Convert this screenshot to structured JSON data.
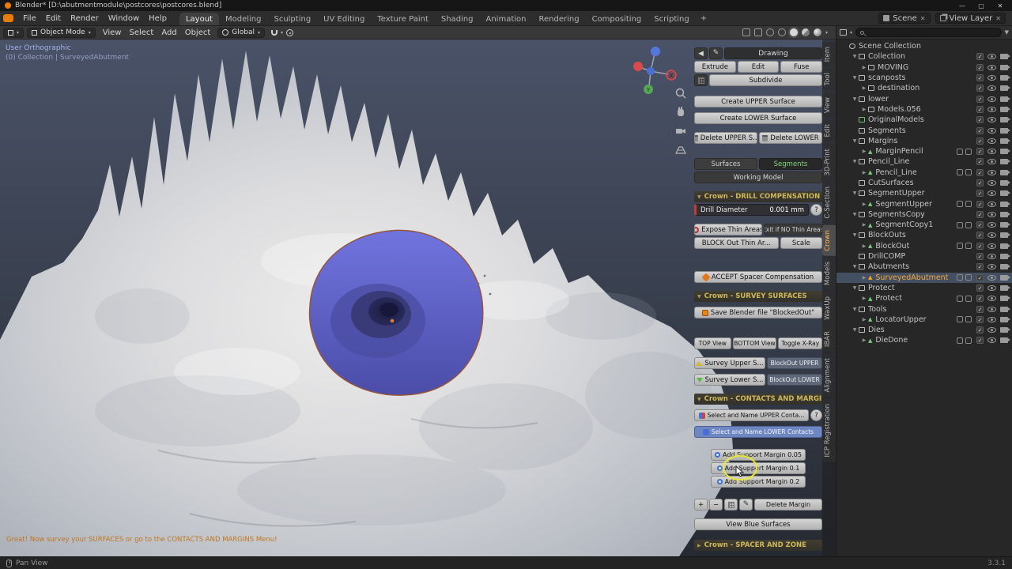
{
  "icons": {
    "minimize": "—",
    "maximize": "▢",
    "close": "✕",
    "dropdown": "▾",
    "collapse": "◀",
    "pencil": "✎",
    "plus": "+",
    "minus": "−",
    "help": "?",
    "check": "✓",
    "arrow_down": "▼",
    "arrow_right": "▶",
    "funnel": "▼",
    "workspace_add": "+",
    "mesh_triangle": "▲"
  },
  "titlebar": {
    "title": "Blender* [D:\\abutmentmodule\\postcores\\postcores.blend]"
  },
  "menubar": {
    "menus": [
      "File",
      "Edit",
      "Render",
      "Window",
      "Help"
    ],
    "workspaces": [
      "Layout",
      "Modeling",
      "Sculpting",
      "UV Editing",
      "Texture Paint",
      "Shading",
      "Animation",
      "Rendering",
      "Compositing",
      "Scripting"
    ],
    "active_workspace": "Layout",
    "scene_label": "Scene",
    "view_layer_label": "View Layer"
  },
  "toolbar": {
    "mode": "Object Mode",
    "menus": [
      "View",
      "Select",
      "Add",
      "Object"
    ],
    "orientation": "Global"
  },
  "viewport": {
    "overlay_line1": "User Orthographic",
    "overlay_line2": "(0) Collection | SurveyedAbutment",
    "hint": "Great! Now survey your SURFACES or go to the CONTACTS AND MARGINS Menu!",
    "axis_x": "X",
    "axis_y": "Y",
    "axis_z": "Z"
  },
  "panel": {
    "drawing_title": "Drawing",
    "extrude": "Extrude",
    "edit": "Edit",
    "fuse": "Fuse",
    "subdivide": "Subdivide",
    "create_upper": "Create UPPER Surface",
    "create_lower": "Create LOWER Surface",
    "delete_upper": "Delete UPPER S...",
    "delete_lower": "Delete LOWER",
    "tab_surfaces": "Surfaces",
    "tab_segments": "Segments",
    "working_model": "Working Model",
    "section_drill": "Crown - DRILL COMPENSATION",
    "drill_label": "Drill Diameter",
    "drill_value": "0.001 mm",
    "expose_thin": "Expose Thin Areas",
    "exit_thin": "Exit if NO Thin Areas",
    "block_thin": "BLOCK Out Thin Ar...",
    "scale": "Scale",
    "accept_spacer": "ACCEPT Spacer Compensation",
    "section_survey": "Crown - SURVEY SURFACES",
    "save_file": "Save Blender file \"BlockedOut\"",
    "top_view": "TOP View",
    "bottom_view": "BOTTOM View",
    "toggle_xray": "Toggle X-Ray",
    "survey_upper": "Survey Upper S...",
    "blockout_upper": "BlockOut UPPER",
    "survey_lower": "Survey Lower S...",
    "blockout_lower": "BlockOut LOWER",
    "section_contacts": "Crown - CONTACTS AND MARGINS",
    "select_upper": "Select and Name UPPER Conta...",
    "select_lower": "Select and Name LOWER Contacts",
    "margin_005": "Add Support Margin 0.05",
    "margin_01": "Add Support Margin 0.1",
    "margin_02": "Add Support Margin 0.2",
    "delete_margin": "Delete Margin",
    "view_blue": "View Blue Surfaces",
    "section_spacer": "Crown - SPACER AND ZONE"
  },
  "side_tabs": [
    "Item",
    "Tool",
    "View",
    "Edit",
    "3D-Print",
    "C-Section",
    "Crown",
    "Models",
    "WaxUp",
    "IBAR",
    "Alignment",
    "ICP Registration"
  ],
  "active_side_tab": "Crown",
  "outliner": {
    "root_label": "Scene Collection",
    "row_icons": [
      "exclude-checkbox",
      "hide-in-viewport-icon",
      "disable-in-render-icon"
    ],
    "items": [
      {
        "indent": 1,
        "arrow": "d",
        "icon": "collection",
        "label": "Collection",
        "extras": false,
        "selected": false
      },
      {
        "indent": 2,
        "arrow": "r",
        "icon": "collection",
        "label": "MOVING",
        "extras": false,
        "selected": false
      },
      {
        "indent": 1,
        "arrow": "d",
        "icon": "collection",
        "label": "scanposts",
        "extras": false,
        "selected": false
      },
      {
        "indent": 2,
        "arrow": "r",
        "icon": "collection",
        "label": "destination",
        "extras": false,
        "selected": false
      },
      {
        "indent": 1,
        "arrow": "d",
        "icon": "collection",
        "label": "lower",
        "extras": false,
        "selected": false
      },
      {
        "indent": 2,
        "arrow": "r",
        "icon": "collection",
        "label": "Models.056",
        "extras": false,
        "selected": false
      },
      {
        "indent": 1,
        "arrow": "",
        "icon": "collection-green",
        "label": "OriginalModels",
        "extras": false,
        "selected": false
      },
      {
        "indent": 1,
        "arrow": "",
        "icon": "collection",
        "label": "Segments",
        "extras": false,
        "selected": false
      },
      {
        "indent": 1,
        "arrow": "d",
        "icon": "collection",
        "label": "Margins",
        "extras": false,
        "selected": false
      },
      {
        "indent": 2,
        "arrow": "r",
        "icon": "mesh",
        "label": "MarginPencil",
        "extras": true,
        "selected": false
      },
      {
        "indent": 1,
        "arrow": "d",
        "icon": "collection",
        "label": "Pencil_Line",
        "extras": false,
        "selected": false
      },
      {
        "indent": 2,
        "arrow": "r",
        "icon": "mesh",
        "label": "Pencil_Line",
        "extras": true,
        "selected": false
      },
      {
        "indent": 1,
        "arrow": "",
        "icon": "collection",
        "label": "CutSurfaces",
        "extras": false,
        "selected": false
      },
      {
        "indent": 1,
        "arrow": "d",
        "icon": "collection",
        "label": "SegmentUpper",
        "extras": false,
        "selected": false
      },
      {
        "indent": 2,
        "arrow": "r",
        "icon": "mesh",
        "label": "SegmentUpper",
        "extras": true,
        "selected": false
      },
      {
        "indent": 1,
        "arrow": "d",
        "icon": "collection",
        "label": "SegmentsCopy",
        "extras": false,
        "selected": false
      },
      {
        "indent": 2,
        "arrow": "r",
        "icon": "mesh",
        "label": "SegmentCopy1",
        "extras": true,
        "selected": false
      },
      {
        "indent": 1,
        "arrow": "d",
        "icon": "collection",
        "label": "BlockOuts",
        "extras": false,
        "selected": false
      },
      {
        "indent": 2,
        "arrow": "r",
        "icon": "mesh",
        "label": "BlockOut",
        "extras": true,
        "selected": false
      },
      {
        "indent": 1,
        "arrow": "",
        "icon": "collection",
        "label": "DrillCOMP",
        "extras": false,
        "selected": false
      },
      {
        "indent": 1,
        "arrow": "d",
        "icon": "collection",
        "label": "Abutments",
        "extras": false,
        "selected": false
      },
      {
        "indent": 2,
        "arrow": "r",
        "icon": "mesh-orange",
        "label": "SurveyedAbutment",
        "extras": true,
        "selected": true
      },
      {
        "indent": 1,
        "arrow": "d",
        "icon": "collection",
        "label": "Protect",
        "extras": false,
        "selected": false
      },
      {
        "indent": 2,
        "arrow": "r",
        "icon": "mesh",
        "label": "Protect",
        "extras": true,
        "selected": false
      },
      {
        "indent": 1,
        "arrow": "d",
        "icon": "collection",
        "label": "Tools",
        "extras": false,
        "selected": false
      },
      {
        "indent": 2,
        "arrow": "r",
        "icon": "mesh",
        "label": "LocatorUpper",
        "extras": true,
        "selected": false
      },
      {
        "indent": 1,
        "arrow": "d",
        "icon": "collection",
        "label": "Dies",
        "extras": false,
        "selected": false
      },
      {
        "indent": 2,
        "arrow": "r",
        "icon": "mesh",
        "label": "DieDone",
        "extras": true,
        "selected": false
      }
    ]
  },
  "statusbar": {
    "pan": "Pan View",
    "version": "3.3.1"
  },
  "colors": {
    "accent_orange": "#e8983f",
    "crater_blue": "#5d61c9",
    "section_gold": "#cdb85e",
    "segments_green": "#7fd87f",
    "highlight_yellow": "#e6e345",
    "selection_row": "#445062"
  }
}
